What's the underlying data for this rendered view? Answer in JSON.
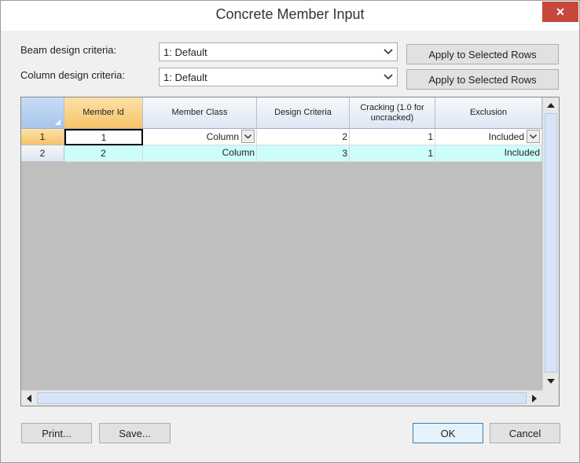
{
  "window": {
    "title": "Concrete Member Input"
  },
  "criteria": {
    "beam_label": "Beam design criteria:",
    "beam_value": "1: Default",
    "column_label": "Column design criteria:",
    "column_value": "1: Default",
    "apply_label": "Apply to Selected Rows"
  },
  "grid": {
    "headers": [
      "Member Id",
      "Member Class",
      "Design Criteria",
      "Cracking (1.0 for uncracked)",
      "Exclusion"
    ],
    "rows": [
      {
        "row_num": "1",
        "member_id": "1",
        "member_class": "Column",
        "design_criteria": "2",
        "cracking": "1",
        "exclusion": "Included"
      },
      {
        "row_num": "2",
        "member_id": "2",
        "member_class": "Column",
        "design_criteria": "3",
        "cracking": "1",
        "exclusion": "Included"
      }
    ]
  },
  "footer": {
    "print_label": "Print...",
    "save_label": "Save...",
    "ok_label": "OK",
    "cancel_label": "Cancel"
  },
  "colors": {
    "close": "#c7483b",
    "active_header": "#f6c36a",
    "row2_fill": "#ccfdfb",
    "grid_empty": "#bfbfbf"
  },
  "icons": {
    "close": "close-icon",
    "dropdown": "chevron-down-icon",
    "scroll_up": "arrow-up-icon",
    "scroll_down": "arrow-down-icon",
    "scroll_left": "arrow-left-icon",
    "scroll_right": "arrow-right-icon"
  }
}
